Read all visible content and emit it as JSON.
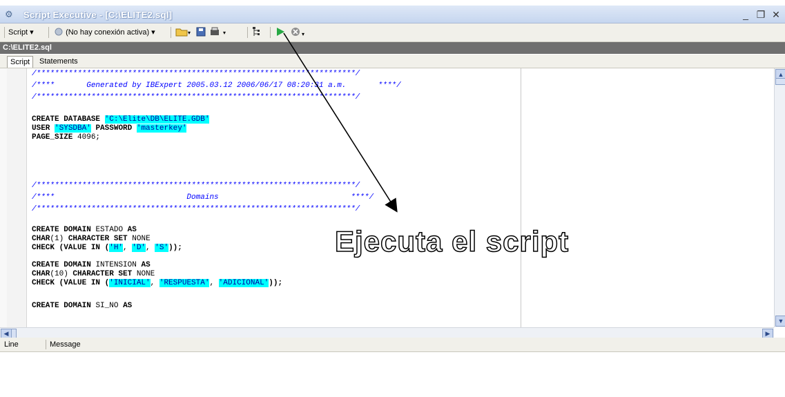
{
  "window": {
    "title": "Script Executive - [C:\\ELITE2.sql]",
    "minimize": "_",
    "restore": "❐",
    "close": "✕"
  },
  "toolbar": {
    "script_label": "Script ▾",
    "connection_label": "(No hay conexión activa) ▾"
  },
  "file_path": "C:\\ELITE2.sql",
  "tabs": [
    {
      "label": "Script"
    },
    {
      "label": "Statements"
    }
  ],
  "code": {
    "stars_line": "/**********************************************************************/",
    "header_comment": "/****       Generated by IBExpert 2005.03.12 2006/06/17 08:20:31 a.m.       ****/",
    "domains_comment": "/****                             Domains                             ****/",
    "create_database_kw": "CREATE DATABASE",
    "database_path": "'C:\\Elite\\DB\\ELITE.GDB'",
    "user_kw": "USER",
    "user_value": "'SYSDBA'",
    "password_kw": "PASSWORD",
    "password_value": "'masterkey'",
    "page_size_kw": "PAGE_SIZE",
    "page_size_value": "4096;",
    "create_domain_kw": "CREATE DOMAIN",
    "as_kw": "AS",
    "domain1_name": "ESTADO",
    "domain1_type_kw": "CHAR",
    "domain1_len": "(1)",
    "charset_kw": "CHARACTER SET",
    "charset_value": "NONE",
    "check_kw": "CHECK (VALUE IN (",
    "domain1_values": [
      "'H'",
      "'D'",
      "'S'"
    ],
    "check_end": "));",
    "domain2_name": "INTENSION",
    "domain2_len": "(10)",
    "domain2_values": [
      "'INICIAL'",
      "'RESPUESTA'",
      "'ADICIONAL'"
    ],
    "domain3_name": "SI_NO"
  },
  "messages": {
    "col_line": "Line",
    "col_message": "Message"
  },
  "annotation": "Ejecuta el script"
}
